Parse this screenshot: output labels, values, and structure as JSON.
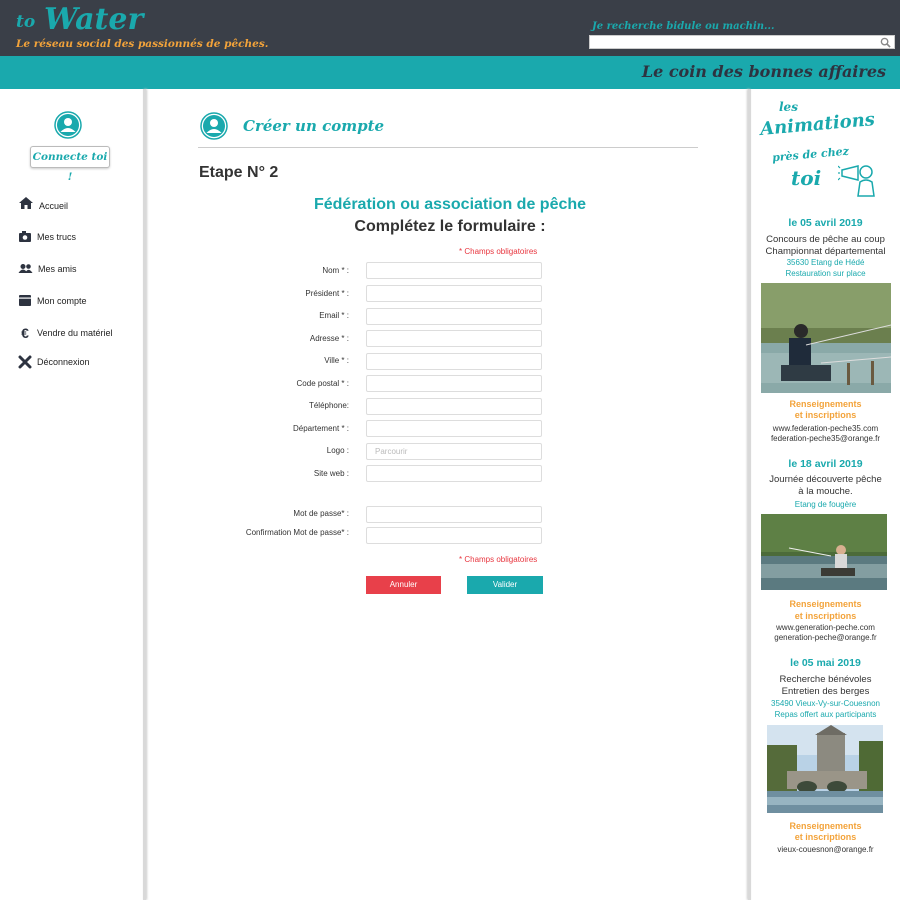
{
  "header": {
    "logo_to": "to",
    "logo_water": "Water",
    "tagline": "Le réseau social des passionnés de pêches.",
    "search_label": "Je recherche bidule ou machin...",
    "search_placeholder": "",
    "bonnes_affaires": "Le coin des bonnes affaires"
  },
  "sidebar": {
    "connect_label": "Connecte toi !",
    "items": [
      {
        "label": "Accueil",
        "icon": "home-icon"
      },
      {
        "label": "Mes trucs",
        "icon": "camera-icon"
      },
      {
        "label": "Mes amis",
        "icon": "users-icon"
      },
      {
        "label": "Mon compte",
        "icon": "card-icon"
      },
      {
        "label": "Vendre du matériel",
        "icon": "euro-icon"
      },
      {
        "label": "Déconnexion",
        "icon": "close-icon"
      }
    ]
  },
  "main": {
    "title": "Créer un compte",
    "step": "Etape N° 2",
    "subtitle": "Fédération ou association de pêche",
    "subtitle2": "Complétez le formulaire :",
    "required_note": "* Champs obligatoires",
    "fields": [
      {
        "label": "Nom * :",
        "value": "",
        "placeholder": ""
      },
      {
        "label": "Président * :",
        "value": "",
        "placeholder": ""
      },
      {
        "label": "Email * :",
        "value": "",
        "placeholder": ""
      },
      {
        "label": "Adresse * :",
        "value": "",
        "placeholder": ""
      },
      {
        "label": "Ville * :",
        "value": "",
        "placeholder": ""
      },
      {
        "label": "Code postal * :",
        "value": "",
        "placeholder": ""
      },
      {
        "label": "Téléphone:",
        "value": "",
        "placeholder": ""
      },
      {
        "label": "Département * :",
        "value": "",
        "placeholder": ""
      },
      {
        "label": "Logo :",
        "value": "",
        "placeholder": "Parcourir"
      },
      {
        "label": "Site web :",
        "value": "",
        "placeholder": ""
      }
    ],
    "password_fields": [
      {
        "label": "Mot de passe* :",
        "value": ""
      },
      {
        "label": "Confirmation Mot de passe* :",
        "value": ""
      }
    ],
    "cancel_label": "Annuler",
    "submit_label": "Valider"
  },
  "right": {
    "heading_les": "les",
    "heading_animations": "Animations",
    "heading_pres": "près de chez",
    "heading_toi": "toi",
    "events": [
      {
        "date": "le 05 avril 2019",
        "title1": "Concours de pêche au coup",
        "title2": "Championnat départemental",
        "sub1": "35630 Etang de Hédé",
        "sub2": "Restauration sur place",
        "rens1": "Renseignements",
        "rens2": "et inscriptions",
        "contact1": "www.federation-peche35.com",
        "contact2": "federation-peche35@orange.fr"
      },
      {
        "date": "le 18 avril 2019",
        "title1": "Journée découverte pêche",
        "title2": "à la mouche.",
        "sub1": "Etang de fougère",
        "rens1": "Renseignements",
        "rens2": "et inscriptions",
        "contact1": "www.generation-peche.com",
        "contact2": "generation-peche@orange.fr"
      },
      {
        "date": "le 05 mai 2019",
        "title1": "Recherche bénévoles",
        "title2": "Entretien des berges",
        "sub1": "35490 Vieux-Vy-sur-Couesnon",
        "sub2": "Repas offert aux participants",
        "rens1": "Renseignements",
        "rens2": "et inscriptions",
        "contact1": "vieux-couesnon@orange.fr"
      }
    ]
  },
  "colors": {
    "teal": "#1aa9ad",
    "dark": "#3a3f48",
    "orange": "#f3a33a",
    "red": "#e8404a"
  }
}
